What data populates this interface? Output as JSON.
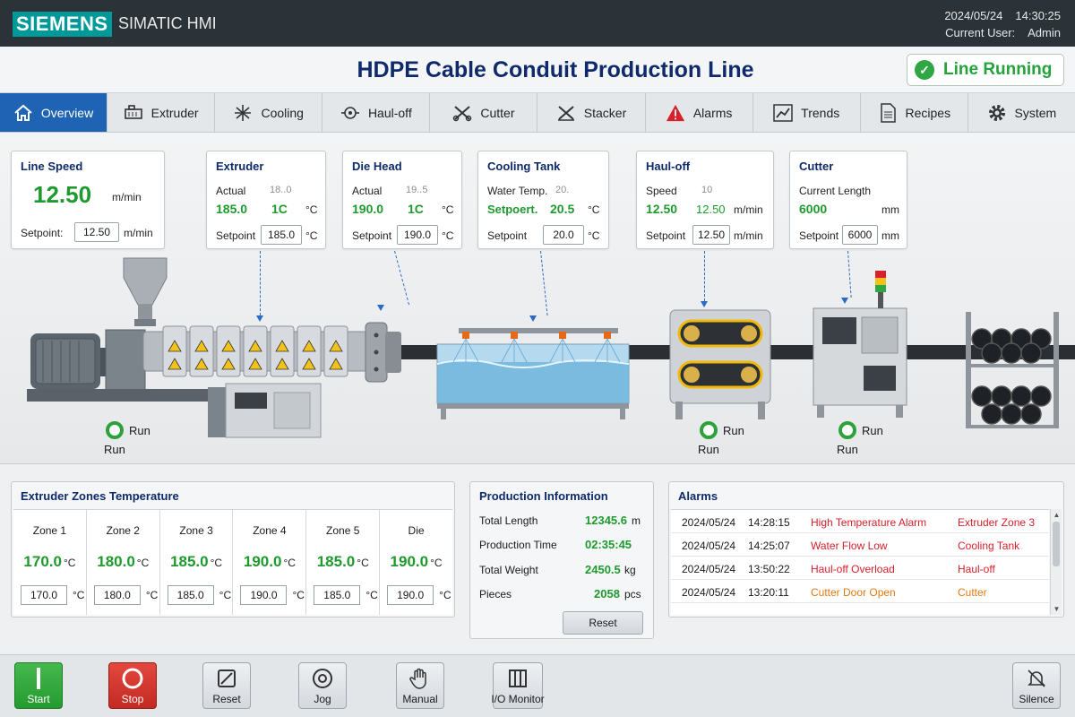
{
  "header": {
    "brand": "SIEMENS",
    "product": "SIMATIC HMI",
    "date": "2024/05/24",
    "time": "14:30:25",
    "user_label": "Current User:",
    "user": "Admin"
  },
  "title": "HDPE Cable Conduit Production Line",
  "status": {
    "label": "Line Running",
    "color": "#23a33a"
  },
  "nav": [
    {
      "label": "Overview",
      "icon": "home-icon"
    },
    {
      "label": "Extruder",
      "icon": "extruder-icon"
    },
    {
      "label": "Cooling",
      "icon": "snowflake-icon"
    },
    {
      "label": "Haul-off",
      "icon": "haul-off-icon"
    },
    {
      "label": "Cutter",
      "icon": "cutter-icon"
    },
    {
      "label": "Stacker",
      "icon": "stacker-icon"
    },
    {
      "label": "Alarms",
      "icon": "warning-icon"
    },
    {
      "label": "Trends",
      "icon": "trend-chart-icon"
    },
    {
      "label": "Recipes",
      "icon": "document-icon"
    },
    {
      "label": "System",
      "icon": "gear-icon"
    }
  ],
  "cards": {
    "line_speed": {
      "title": "Line Speed",
      "value": "12.50",
      "unit": "m/min",
      "setpoint_label": "Setpoint:",
      "setpoint": "12.50",
      "setpoint_unit": "m/min"
    },
    "extruder": {
      "title": "Extruder",
      "actual_label": "Actual",
      "actual_value": "185.0",
      "actual_ghost": "18..0",
      "actual_sec": "1C",
      "unit": "°C",
      "setpoint_label": "Setpoint",
      "setpoint": "185.0"
    },
    "die_head": {
      "title": "Die Head",
      "actual_label": "Actual",
      "actual_value": "190.0",
      "actual_ghost": "19..5",
      "actual_sec": "1C",
      "unit": "°C",
      "setpoint_label": "Setpoint",
      "setpoint": "190.0"
    },
    "cooling": {
      "title": "Cooling Tank",
      "water_label": "Water Temp.",
      "water_ghost": "20.",
      "setpoint_ghost": "Setpoert.",
      "water_value": "20.5",
      "unit": "°C",
      "setpoint_label": "Setpoint",
      "setpoint": "20.0"
    },
    "haul_off": {
      "title": "Haul-off",
      "speed_label": "Speed",
      "speed_ghost": "10",
      "value1": "12.50",
      "value2": "12.50",
      "unit": "m/min",
      "setpoint_label": "Setpoint",
      "setpoint": "12.50"
    },
    "cutter": {
      "title": "Cutter",
      "length_label": "Current Length",
      "value": "6000",
      "unit": "mm",
      "setpoint_label": "Setpoint",
      "setpoint": "6000"
    }
  },
  "run_indicators": [
    {
      "label": "Run",
      "sub": "Run"
    },
    {
      "label": "Run",
      "sub": "Run"
    },
    {
      "label": "Run",
      "sub": "Run"
    }
  ],
  "zones_panel": {
    "title": "Extruder Zones Temperature",
    "unit": "°C",
    "zones": [
      {
        "name": "Zone 1",
        "actual": "170.0",
        "setpoint": "170.0"
      },
      {
        "name": "Zone 2",
        "actual": "180.0",
        "setpoint": "180.0"
      },
      {
        "name": "Zone 3",
        "actual": "185.0",
        "setpoint": "185.0"
      },
      {
        "name": "Zone 4",
        "actual": "190.0",
        "setpoint": "190.0"
      },
      {
        "name": "Zone 5",
        "actual": "185.0",
        "setpoint": "185.0"
      },
      {
        "name": "Die",
        "actual": "190.0",
        "setpoint": "190.0"
      }
    ]
  },
  "production": {
    "title": "Production Information",
    "rows": [
      {
        "label": "Total Length",
        "value": "12345.6",
        "unit": "m"
      },
      {
        "label": "Production Time",
        "value": "02:35:45",
        "unit": ""
      },
      {
        "label": "Total Weight",
        "value": "2450.5",
        "unit": "kg"
      },
      {
        "label": "Pieces",
        "value": "2058",
        "unit": "pcs"
      }
    ],
    "reset_label": "Reset"
  },
  "alarms": {
    "title": "Alarms",
    "rows": [
      {
        "date": "2024/05/24",
        "time": "14:28:15",
        "message": "High Temperature Alarm",
        "source": "Extruder Zone 3",
        "color": "#d8202a"
      },
      {
        "date": "2024/05/24",
        "time": "14:25:07",
        "message": "Water Flow Low",
        "source": "Cooling Tank",
        "color": "#d8202a"
      },
      {
        "date": "2024/05/24",
        "time": "13:50:22",
        "message": "Haul-off Overload",
        "source": "Haul-off",
        "color": "#d8202a"
      },
      {
        "date": "2024/05/24",
        "time": "13:20:11",
        "message": "Cutter Door Open",
        "source": "Cutter",
        "color": "#e07a10"
      }
    ]
  },
  "footer": {
    "start": "Start",
    "stop": "Stop",
    "reset": "Reset",
    "jog": "Jog",
    "manual": "Manual",
    "io_monitor": "I/O Monitor",
    "silence": "Silence"
  }
}
